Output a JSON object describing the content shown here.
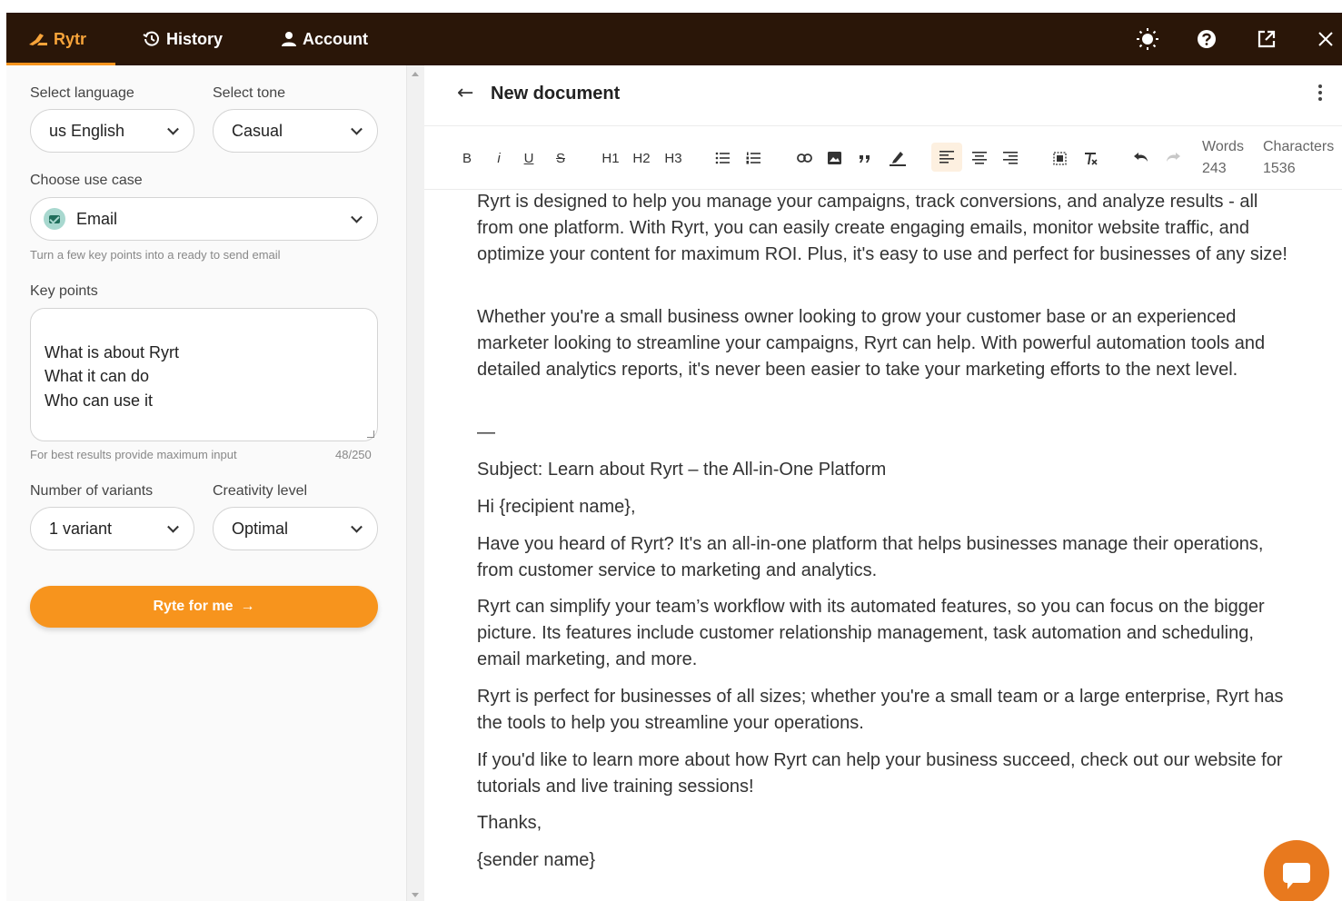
{
  "topbar": {
    "brand": "Rytr",
    "history": "History",
    "account": "Account",
    "icons": [
      "theme-toggle-icon",
      "help-icon",
      "open-external-icon",
      "close-icon"
    ],
    "accent": "#f7941d",
    "background": "#2a1608"
  },
  "left_panel": {
    "language_label": "Select language",
    "language_value": "us English",
    "tone_label": "Select tone",
    "tone_value": "Casual",
    "use_case_label": "Choose use case",
    "use_case_value": "Email",
    "use_case_hint": "Turn a few key points into a ready to send email",
    "key_points_label": "Key points",
    "key_points_value": "What is about Ryrt\nWhat it can do\nWho can use it",
    "key_points_hint": "For best results provide maximum input",
    "key_points_count": "48/250",
    "variants_label": "Number of variants",
    "variants_value": "1 variant",
    "creativity_label": "Creativity level",
    "creativity_value": "Optimal",
    "ryte_button": "Ryte for me",
    "ryte_arrow": "→"
  },
  "editor": {
    "back_arrow": "←",
    "title": "New document",
    "toolbar": {
      "bold": "B",
      "italic": "i",
      "underline": "U",
      "strike": "S",
      "h1": "H1",
      "h2": "H2",
      "h3": "H3"
    },
    "words_label": "Words",
    "words_value": "243",
    "characters_label": "Characters",
    "characters_value": "1536",
    "paragraphs": [
      "Ryrt is designed to help you manage your campaigns, track conversions, and analyze results - all from one platform. With Ryrt, you can easily create engaging emails, monitor website traffic, and optimize your content for maximum ROI. Plus, it's easy to use and perfect for businesses of any size!",
      "Whether you're a small business owner looking to grow your customer base or an experienced marketer looking to streamline your campaigns, Ryrt can help. With powerful automation tools and detailed analytics reports, it's never been easier to take your marketing efforts to the next level.",
      "—",
      "Subject: Learn about Ryrt – the All-in-One Platform",
      "Hi {recipient name},",
      "Have you heard of Ryrt? It's an all-in-one platform that helps businesses manage their operations, from customer service to marketing and analytics.",
      "Ryrt can simplify your team’s workflow with its automated features, so you can focus on the bigger picture. Its features include customer relationship management, task automation and scheduling, email marketing, and more.",
      "Ryrt is perfect for businesses of all sizes; whether you're a small team or a large enterprise, Ryrt has the tools to help you streamline your operations.",
      "If you'd like to learn more about how Ryrt can help your business succeed, check out our website for tutorials and live training sessions!",
      "Thanks,",
      "{sender name}"
    ]
  }
}
